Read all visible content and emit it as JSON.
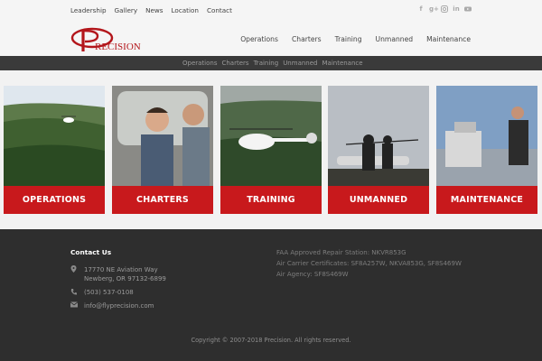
{
  "top_links": [
    "Leadership",
    "Gallery",
    "News",
    "Location",
    "Contact"
  ],
  "social_icons": [
    "facebook-icon",
    "google-plus-icon",
    "instagram-icon",
    "linkedin-icon",
    "youtube-icon"
  ],
  "logo": {
    "text": "RECISION",
    "brand_color": "#b3161b"
  },
  "main_nav": [
    "Operations",
    "Charters",
    "Training",
    "Unmanned",
    "Maintenance"
  ],
  "sub_nav": [
    "Operations",
    "Charters",
    "Training",
    "Unmanned",
    "Maintenance"
  ],
  "tiles": [
    {
      "label": "OPERATIONS"
    },
    {
      "label": "CHARTERS"
    },
    {
      "label": "TRAINING"
    },
    {
      "label": "UNMANNED"
    },
    {
      "label": "MAINTENANCE"
    }
  ],
  "colors": {
    "accent": "#c8191c",
    "footer_bg": "#2e2e2e",
    "subbar_bg": "#3a3a3a"
  },
  "footer": {
    "contact_title": "Contact Us",
    "address_line1": "17770 NE Aviation Way",
    "address_line2": "Newberg, OR 97132-6899",
    "phone": "(503) 537-0108",
    "email": "info@flyprecision.com",
    "cert_line1": "FAA Approved Repair Station: NKVR853G",
    "cert_line2": "Air Carrier Certificates: SF8A257W, NKVA853G, SF8S469W",
    "cert_line3": "Air Agency: SF8S469W",
    "copyright": "Copyright © 2007-2018 Precision. All rights reserved."
  }
}
